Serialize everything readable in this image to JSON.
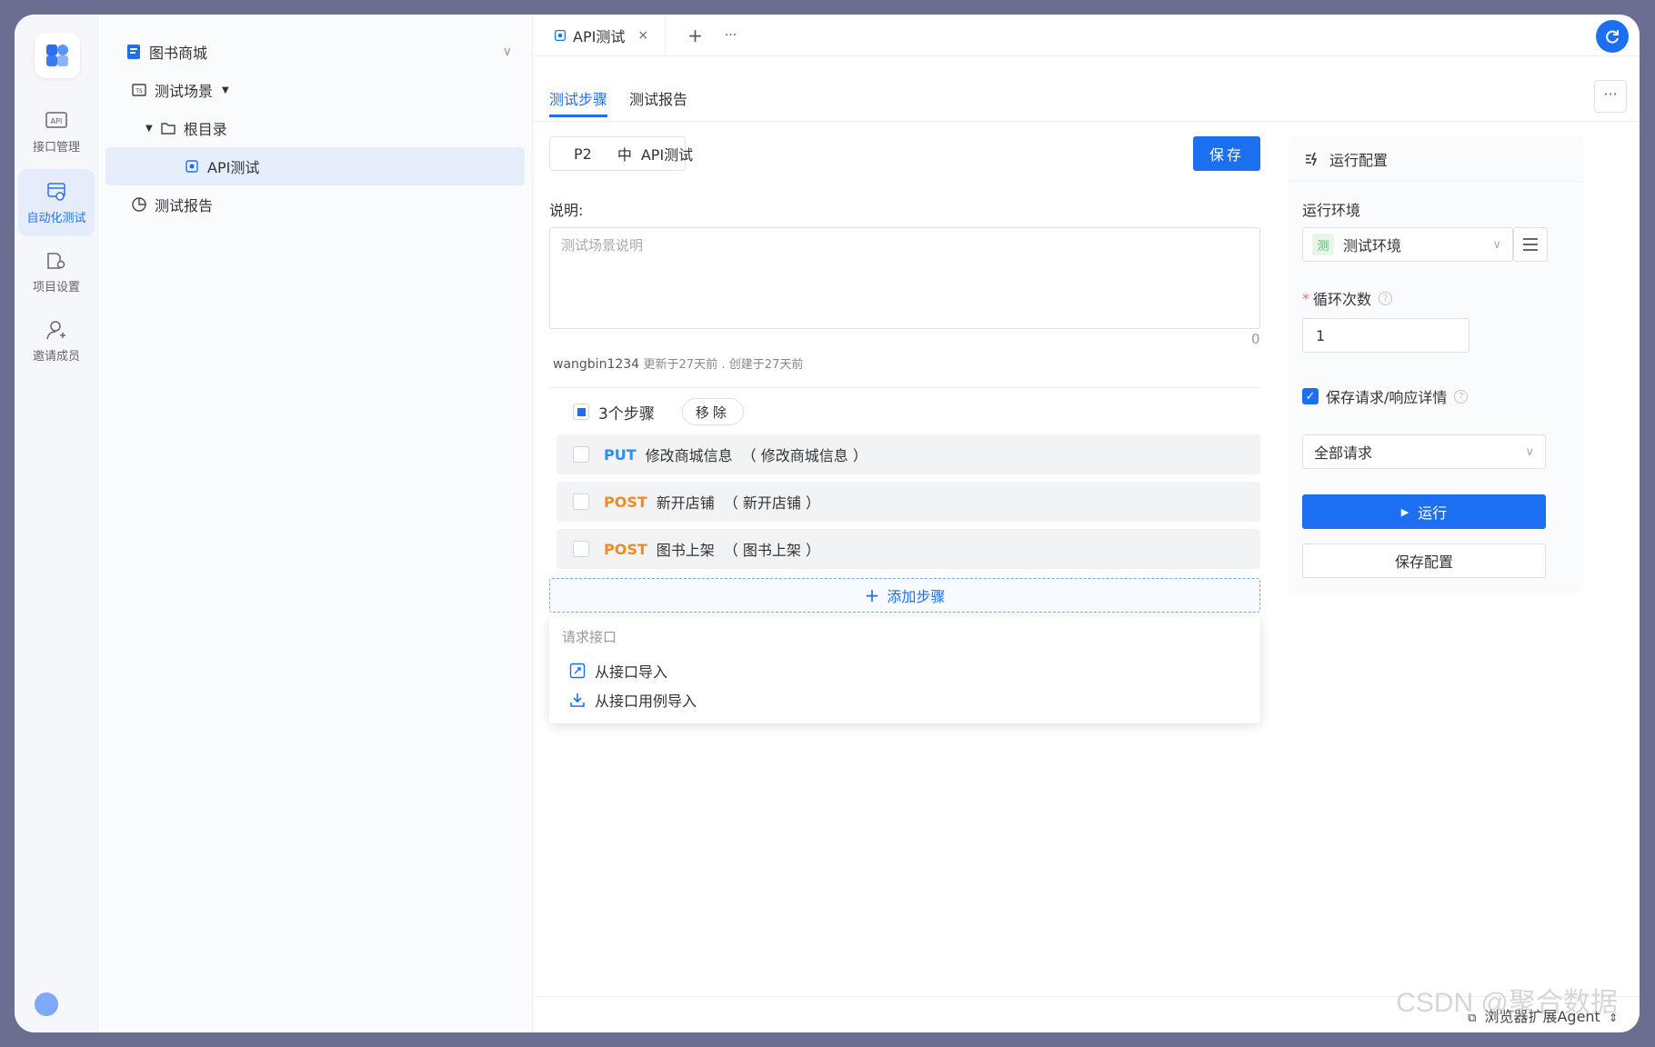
{
  "rail": {
    "items": [
      {
        "label": "接口管理",
        "icon": "api-icon"
      },
      {
        "label": "自动化测试",
        "icon": "automation-icon"
      },
      {
        "label": "项目设置",
        "icon": "project-settings-icon"
      },
      {
        "label": "邀请成员",
        "icon": "invite-member-icon"
      }
    ],
    "active_index": 1
  },
  "tree": {
    "project": "图书商城",
    "scenario_group": "测试场景",
    "root_folder": "根目录",
    "selected_item": "API测试",
    "report": "测试报告"
  },
  "tabbar": {
    "open_tab": "API测试",
    "close_glyph": "×",
    "add_glyph": "+",
    "more_glyph": "···"
  },
  "subtabs": {
    "steps": "测试步骤",
    "report": "测试报告",
    "more_glyph": "···"
  },
  "scenario": {
    "priority": "P2",
    "level": "中",
    "name": "API测试",
    "save_label": "保存",
    "description_label": "说明:",
    "description_placeholder": "测试场景说明",
    "char_count": "0",
    "author": "wangbin1234",
    "updated": "更新于27天前",
    "created": "创建于27天前"
  },
  "steps": {
    "count_label": "3个步骤",
    "remove_label": "移除",
    "items": [
      {
        "method": "PUT",
        "name": "修改商城信息",
        "alias": "（ 修改商城信息 ）"
      },
      {
        "method": "POST",
        "name": "新开店铺",
        "alias": "（ 新开店铺 ）"
      },
      {
        "method": "POST",
        "name": "图书上架",
        "alias": "（ 图书上架 ）"
      }
    ],
    "add_label": "添加步骤"
  },
  "add_menu": {
    "group": "请求接口",
    "items": [
      "从接口导入",
      "从接口用例导入"
    ]
  },
  "run_config": {
    "title": "运行配置",
    "env_label": "运行环境",
    "env_tag": "测",
    "env_value": "测试环境",
    "loop_label": "循环次数",
    "loop_value": "1",
    "save_detail_label": "保存请求/响应详情",
    "save_detail_checked": true,
    "request_filter": "全部请求",
    "run_label": "运行",
    "save_config_label": "保存配置"
  },
  "status_bar": {
    "agent": "浏览器扩展Agent"
  },
  "watermark": "CSDN @聚合数据",
  "colors": {
    "primary": "#1d6ff2",
    "put": "#2b8ef0",
    "post": "#f08a24",
    "frame": "#6b6e91"
  }
}
